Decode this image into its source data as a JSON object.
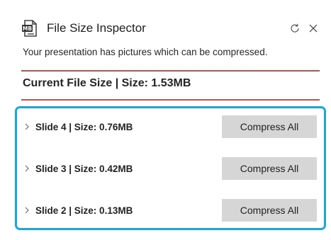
{
  "header": {
    "title": "File Size Inspector",
    "app_icon": "mb-file-icon",
    "refresh_icon": "refresh-icon",
    "close_icon": "close-icon"
  },
  "subtitle": "Your presentation has pictures which can be compressed.",
  "current_size": "Current File Size | Size: 1.53MB",
  "slides": [
    {
      "label": "Slide 4 | Size: 0.76MB",
      "button": "Compress All"
    },
    {
      "label": "Slide 3 | Size: 0.42MB",
      "button": "Compress All"
    },
    {
      "label": "Slide 2 | Size: 0.13MB",
      "button": "Compress All"
    }
  ],
  "colors": {
    "accent_rule": "#b9554a",
    "highlight_border": "#1aa8d6",
    "button_bg": "#d6d6d6"
  }
}
